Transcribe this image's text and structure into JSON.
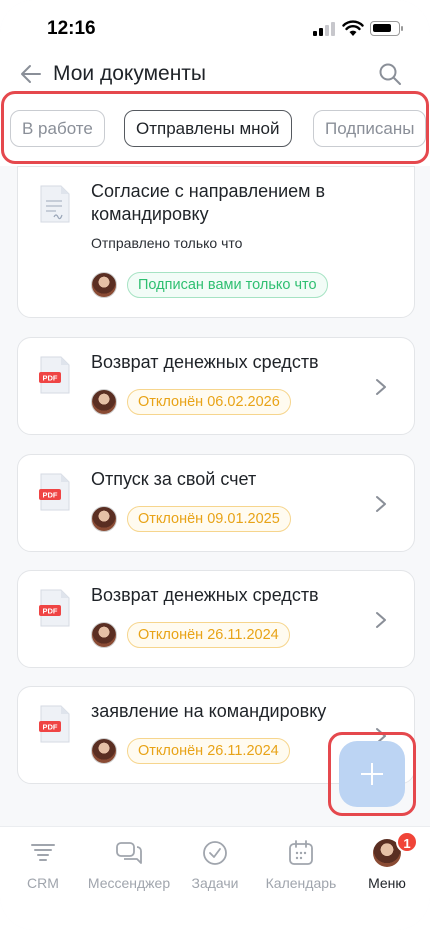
{
  "status_bar": {
    "time": "12:16"
  },
  "header": {
    "title": "Мои документы"
  },
  "tabs": [
    {
      "label": "В работе",
      "active": false
    },
    {
      "label": "Отправлены мной",
      "active": true
    },
    {
      "label": "Подписаны",
      "active": false
    }
  ],
  "documents": [
    {
      "title": "Согласие с направлением в командировку",
      "subtitle": "Отправлено только что",
      "status": "Подписан вами только что",
      "status_color": "#2fbf71",
      "icon": "signed-doc-icon"
    },
    {
      "title": "Возврат денежных средств",
      "status": "Отклонён 06.02.2026",
      "status_color": "#e8a317",
      "icon": "pdf-icon"
    },
    {
      "title": "Отпуск за свой счет",
      "status": "Отклонён 09.01.2025",
      "status_color": "#e8a317",
      "icon": "pdf-icon"
    },
    {
      "title": "Возврат денежных средств",
      "status": "Отклонён 26.11.2024",
      "status_color": "#e8a317",
      "icon": "pdf-icon"
    },
    {
      "title": "заявление на командировку",
      "status": "Отклонён 26.11.2024",
      "status_color": "#e8a317",
      "icon": "pdf-icon"
    }
  ],
  "pdf_label": "PDF",
  "fab": {
    "icon": "plus-icon"
  },
  "bottom_nav": [
    {
      "label": "CRM",
      "icon": "crm-icon"
    },
    {
      "label": "Мессенджер",
      "icon": "messenger-icon"
    },
    {
      "label": "Задачи",
      "icon": "tasks-icon"
    },
    {
      "label": "Календарь",
      "icon": "calendar-icon"
    },
    {
      "label": "Меню",
      "icon": "avatar",
      "badge": "1",
      "active": true
    }
  ],
  "colors": {
    "accent_highlight": "#e5484d",
    "fab": "#bcd4f3",
    "pdf_red": "#ef4444"
  }
}
